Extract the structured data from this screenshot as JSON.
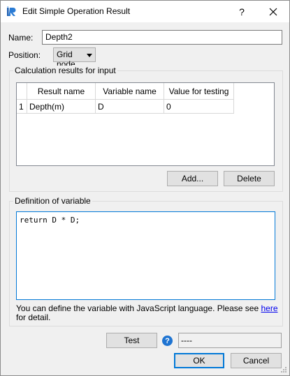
{
  "window": {
    "title": "Edit Simple Operation Result",
    "help_symbol": "?"
  },
  "form": {
    "name_label": "Name:",
    "name_value": "Depth2",
    "position_label": "Position:",
    "position_value": "Grid node"
  },
  "calc_group": {
    "title": "Calculation results for input",
    "columns": [
      "Result name",
      "Variable name",
      "Value for testing"
    ],
    "rows": [
      {
        "index": "1",
        "result_name": "Depth(m)",
        "variable_name": "D",
        "value": "0"
      }
    ],
    "add_label": "Add...",
    "delete_label": "Delete"
  },
  "definition_group": {
    "title": "Definition of variable",
    "code": "return D * D;",
    "info_text": "You can define the variable with JavaScript language. Please see ",
    "info_link": "here",
    "info_text_end": "for detail."
  },
  "footer": {
    "test_label": "Test",
    "result_value": "----",
    "ok_label": "OK",
    "cancel_label": "Cancel"
  },
  "icons": {
    "app": "ir-app-icon",
    "help": "question-icon",
    "close": "close-icon",
    "accent_color": "#0078d7"
  }
}
